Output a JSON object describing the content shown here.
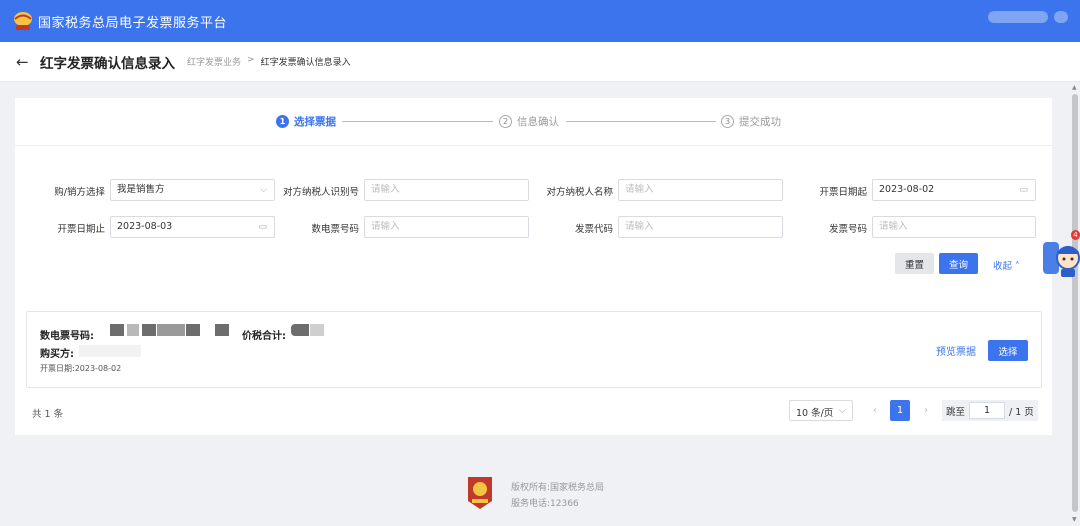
{
  "app": {
    "title": "国家税务总局电子发票服务平台"
  },
  "header": {
    "page_title": "红字发票确认信息录入",
    "breadcrumb": [
      "红字发票业务",
      "红字发票确认信息录入"
    ],
    "breadcrumb_separator": ">"
  },
  "steps": [
    {
      "num": "1",
      "label": "选择票据",
      "active": true
    },
    {
      "num": "2",
      "label": "信息确认",
      "active": false
    },
    {
      "num": "3",
      "label": "提交成功",
      "active": false
    }
  ],
  "form": {
    "buyer_seller": {
      "label": "购/销方选择",
      "value": "我是销售方"
    },
    "counterparty_tax_id": {
      "label": "对方纳税人识别号",
      "placeholder": "请输入"
    },
    "counterparty_name": {
      "label": "对方纳税人名称",
      "placeholder": "请输入"
    },
    "date_start": {
      "label": "开票日期起",
      "value": "2023-08-02"
    },
    "date_end": {
      "label": "开票日期止",
      "value": "2023-08-03"
    },
    "einvoice_number": {
      "label": "数电票号码",
      "placeholder": "请输入"
    },
    "invoice_code": {
      "label": "发票代码",
      "placeholder": "请输入"
    },
    "invoice_number": {
      "label": "发票号码",
      "placeholder": "请输入"
    },
    "reset_label": "重置",
    "query_label": "查询",
    "collapse_label": "收起"
  },
  "result": {
    "einvoice_label": "数电票号码:",
    "total_label": "价税合计:",
    "buyer_label": "购买方:",
    "date_text": "开票日期:2023-08-02",
    "preview_label": "预览票据",
    "select_label": "选择"
  },
  "pagination": {
    "total_text": "共 1 条",
    "page_size": "10 条/页",
    "current_page": "1",
    "jump_label": "跳至",
    "jump_value": "1",
    "page_total": "/ 1 页"
  },
  "footer": {
    "copyright": "版权所有:国家税务总局",
    "phone": "服务电话:12366"
  },
  "helper": {
    "badge": "4"
  },
  "colors": {
    "primary": "#3b74ec",
    "header_bg": "#3b74ec",
    "page_bg": "#f0f1f4"
  }
}
